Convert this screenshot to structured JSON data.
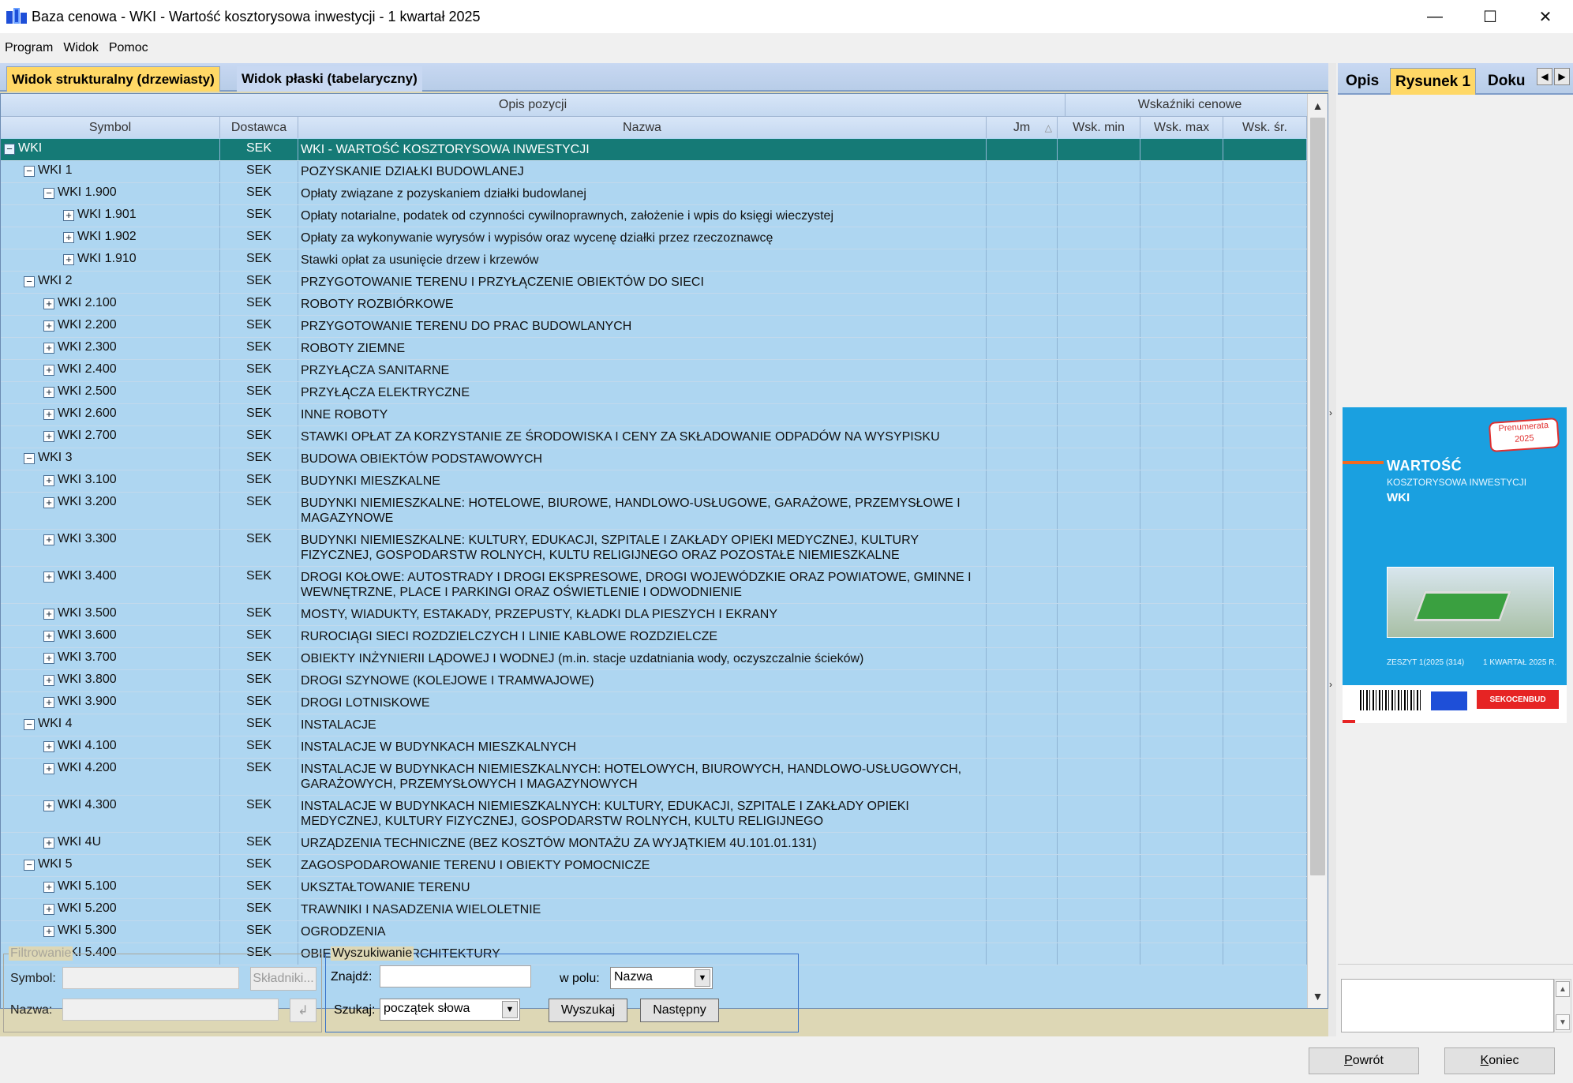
{
  "window": {
    "title": "Baza cenowa - WKI - Wartość kosztorysowa inwestycji - 1 kwartał 2025",
    "minimize_glyph": "—",
    "maximize_glyph": "☐",
    "close_glyph": "✕"
  },
  "menu": [
    "Program",
    "Widok",
    "Pomoc"
  ],
  "view_tabs": {
    "structural": "Widok strukturalny (drzewiasty)",
    "flat": "Widok płaski (tabelaryczny)"
  },
  "grid": {
    "group_headers": {
      "opis": "Opis pozycji",
      "wskazniki": "Wskaźniki cenowe"
    },
    "columns": {
      "symbol": "Symbol",
      "dostawca": "Dostawca",
      "nazwa": "Nazwa",
      "jm": "Jm",
      "wsk_min": "Wsk. min",
      "wsk_max": "Wsk. max",
      "wsk_sr": "Wsk. śr."
    },
    "sort_indicator": "△",
    "rows": [
      {
        "level": 0,
        "exp": "−",
        "symbol": "WKI",
        "dostawca": "SEK",
        "nazwa": "WKI - WARTOŚĆ KOSZTORYSOWA INWESTYCJI",
        "selected": true
      },
      {
        "level": 1,
        "exp": "−",
        "symbol": "WKI 1",
        "dostawca": "SEK",
        "nazwa": "POZYSKANIE DZIAŁKI BUDOWLANEJ"
      },
      {
        "level": 2,
        "exp": "−",
        "symbol": "WKI 1.900",
        "dostawca": "SEK",
        "nazwa": "Opłaty związane z pozyskaniem działki budowlanej"
      },
      {
        "level": 3,
        "exp": "+",
        "symbol": "WKI 1.901",
        "dostawca": "SEK",
        "nazwa": "Opłaty notarialne, podatek od czynności cywilnoprawnych, założenie i wpis do księgi wieczystej"
      },
      {
        "level": 3,
        "exp": "+",
        "symbol": "WKI 1.902",
        "dostawca": "SEK",
        "nazwa": "Opłaty za wykonywanie wyrysów i wypisów oraz wycenę działki przez rzeczoznawcę"
      },
      {
        "level": 3,
        "exp": "+",
        "symbol": "WKI 1.910",
        "dostawca": "SEK",
        "nazwa": "Stawki opłat za usunięcie drzew i krzewów"
      },
      {
        "level": 1,
        "exp": "−",
        "symbol": "WKI 2",
        "dostawca": "SEK",
        "nazwa": "PRZYGOTOWANIE TERENU I PRZYŁĄCZENIE OBIEKTÓW DO SIECI"
      },
      {
        "level": 2,
        "exp": "+",
        "symbol": "WKI 2.100",
        "dostawca": "SEK",
        "nazwa": "ROBOTY ROZBIÓRKOWE"
      },
      {
        "level": 2,
        "exp": "+",
        "symbol": "WKI 2.200",
        "dostawca": "SEK",
        "nazwa": "PRZYGOTOWANIE TERENU DO PRAC BUDOWLANYCH"
      },
      {
        "level": 2,
        "exp": "+",
        "symbol": "WKI 2.300",
        "dostawca": "SEK",
        "nazwa": "ROBOTY ZIEMNE"
      },
      {
        "level": 2,
        "exp": "+",
        "symbol": "WKI 2.400",
        "dostawca": "SEK",
        "nazwa": "PRZYŁĄCZA SANITARNE"
      },
      {
        "level": 2,
        "exp": "+",
        "symbol": "WKI 2.500",
        "dostawca": "SEK",
        "nazwa": "PRZYŁĄCZA ELEKTRYCZNE"
      },
      {
        "level": 2,
        "exp": "+",
        "symbol": "WKI 2.600",
        "dostawca": "SEK",
        "nazwa": "INNE ROBOTY"
      },
      {
        "level": 2,
        "exp": "+",
        "symbol": "WKI 2.700",
        "dostawca": "SEK",
        "nazwa": "STAWKI OPŁAT ZA KORZYSTANIE ZE ŚRODOWISKA I CENY ZA SKŁADOWANIE ODPADÓW NA WYSYPISKU"
      },
      {
        "level": 1,
        "exp": "−",
        "symbol": "WKI 3",
        "dostawca": "SEK",
        "nazwa": "BUDOWA OBIEKTÓW PODSTAWOWYCH"
      },
      {
        "level": 2,
        "exp": "+",
        "symbol": "WKI 3.100",
        "dostawca": "SEK",
        "nazwa": "BUDYNKI MIESZKALNE"
      },
      {
        "level": 2,
        "exp": "+",
        "symbol": "WKI 3.200",
        "dostawca": "SEK",
        "nazwa": "BUDYNKI NIEMIESZKALNE: HOTELOWE, BIUROWE, HANDLOWO-USŁUGOWE, GARAŻOWE, PRZEMYSŁOWE I MAGAZYNOWE"
      },
      {
        "level": 2,
        "exp": "+",
        "symbol": "WKI 3.300",
        "dostawca": "SEK",
        "nazwa": "BUDYNKI NIEMIESZKALNE: KULTURY, EDUKACJI, SZPITALE I ZAKŁADY OPIEKI MEDYCZNEJ, KULTURY FIZYCZNEJ, GOSPODARSTW ROLNYCH, KULTU RELIGIJNEGO ORAZ POZOSTAŁE NIEMIESZKALNE"
      },
      {
        "level": 2,
        "exp": "+",
        "symbol": "WKI 3.400",
        "dostawca": "SEK",
        "nazwa": "DROGI KOŁOWE: AUTOSTRADY I DROGI EKSPRESOWE, DROGI WOJEWÓDZKIE ORAZ POWIATOWE, GMINNE I WEWNĘTRZNE, PLACE I PARKINGI ORAZ OŚWIETLENIE I ODWODNIENIE"
      },
      {
        "level": 2,
        "exp": "+",
        "symbol": "WKI 3.500",
        "dostawca": "SEK",
        "nazwa": "MOSTY, WIADUKTY, ESTAKADY, PRZEPUSTY, KŁADKI DLA PIESZYCH I EKRANY"
      },
      {
        "level": 2,
        "exp": "+",
        "symbol": "WKI 3.600",
        "dostawca": "SEK",
        "nazwa": "RUROCIĄGI SIECI ROZDZIELCZYCH I LINIE KABLOWE ROZDZIELCZE"
      },
      {
        "level": 2,
        "exp": "+",
        "symbol": "WKI 3.700",
        "dostawca": "SEK",
        "nazwa": "OBIEKTY INŻYNIERII LĄDOWEJ I WODNEJ (m.in. stacje uzdatniania wody, oczyszczalnie ścieków)"
      },
      {
        "level": 2,
        "exp": "+",
        "symbol": "WKI 3.800",
        "dostawca": "SEK",
        "nazwa": "DROGI SZYNOWE (KOLEJOWE I TRAMWAJOWE)"
      },
      {
        "level": 2,
        "exp": "+",
        "symbol": "WKI 3.900",
        "dostawca": "SEK",
        "nazwa": "DROGI LOTNISKOWE"
      },
      {
        "level": 1,
        "exp": "−",
        "symbol": "WKI 4",
        "dostawca": "SEK",
        "nazwa": "INSTALACJE"
      },
      {
        "level": 2,
        "exp": "+",
        "symbol": "WKI 4.100",
        "dostawca": "SEK",
        "nazwa": "INSTALACJE W BUDYNKACH MIESZKALNYCH"
      },
      {
        "level": 2,
        "exp": "+",
        "symbol": "WKI 4.200",
        "dostawca": "SEK",
        "nazwa": "INSTALACJE W BUDYNKACH NIEMIESZKALNYCH: HOTELOWYCH, BIUROWYCH, HANDLOWO-USŁUGOWYCH, GARAŻOWYCH, PRZEMYSŁOWYCH I MAGAZYNOWYCH"
      },
      {
        "level": 2,
        "exp": "+",
        "symbol": "WKI 4.300",
        "dostawca": "SEK",
        "nazwa": "INSTALACJE W BUDYNKACH NIEMIESZKALNYCH: KULTURY, EDUKACJI, SZPITALE I ZAKŁADY OPIEKI MEDYCZNEJ, KULTURY FIZYCZNEJ, GOSPODARSTW ROLNYCH, KULTU RELIGIJNEGO"
      },
      {
        "level": 2,
        "exp": "+",
        "symbol": "WKI 4U",
        "dostawca": "SEK",
        "nazwa": "URZĄDZENIA TECHNICZNE (BEZ KOSZTÓW MONTAŻU ZA WYJĄTKIEM 4U.101.01.131)"
      },
      {
        "level": 1,
        "exp": "−",
        "symbol": "WKI 5",
        "dostawca": "SEK",
        "nazwa": "ZAGOSPODAROWANIE TERENU I OBIEKTY POMOCNICZE"
      },
      {
        "level": 2,
        "exp": "+",
        "symbol": "WKI 5.100",
        "dostawca": "SEK",
        "nazwa": "UKSZTAŁTOWANIE TERENU"
      },
      {
        "level": 2,
        "exp": "+",
        "symbol": "WKI 5.200",
        "dostawca": "SEK",
        "nazwa": "TRAWNIKI I NASADZENIA WIELOLETNIE"
      },
      {
        "level": 2,
        "exp": "+",
        "symbol": "WKI 5.300",
        "dostawca": "SEK",
        "nazwa": "OGRODZENIA"
      },
      {
        "level": 2,
        "exp": "+",
        "symbol": "WKI 5.400",
        "dostawca": "SEK",
        "nazwa": "OBIEKTY MAŁEJ ARCHITEKTURY"
      }
    ]
  },
  "filter": {
    "legend": "Filtrowanie",
    "symbol_label": "Symbol:",
    "symbol_value": "",
    "skladniki_button": "Składniki...",
    "nazwa_label": "Nazwa:",
    "nazwa_value": "",
    "clear_glyph": "↲"
  },
  "search": {
    "legend": "Wyszukiwanie",
    "znajdz_label": "Znajdź:",
    "znajdz_value": "",
    "w_polu_label": "w polu:",
    "w_polu_value": "Nazwa",
    "szukaj_label": "Szukaj:",
    "szukaj_value": "początek słowa",
    "wyszukaj_button": "Wyszukaj",
    "nastepny_button": "Następny"
  },
  "right_panel": {
    "tabs": [
      "Opis",
      "Rysunek 1",
      "Doku"
    ],
    "cover": {
      "title": "WARTOŚĆ",
      "subtitle": "KOSZTORYSOWA INWESTYCJI",
      "code": "WKI",
      "badge": "Prenumerata 2025",
      "issue_left": "ZESZYT 1(2025 (314)",
      "issue_right": "1 KWARTAŁ 2025 R.",
      "publisher": "SEKOCENBUD"
    }
  },
  "footer": {
    "back_mnemonic": "P",
    "back_rest": "owrót",
    "end_mnemonic": "K",
    "end_rest": "oniec"
  },
  "colors": {
    "grid_bg": "#aed6f1",
    "selected_row": "#157a76",
    "active_tab": "#ffd866",
    "panel_bg": "#ddd7b5"
  }
}
